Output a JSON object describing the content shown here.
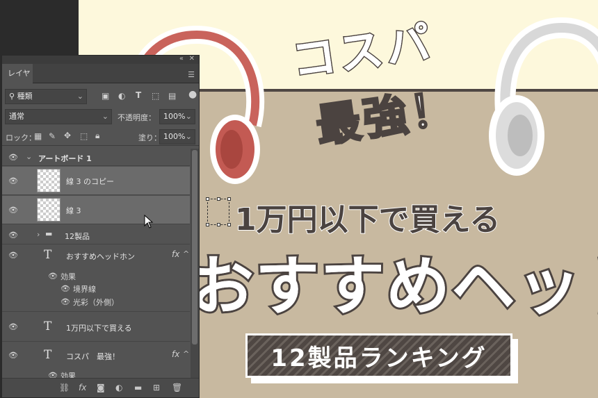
{
  "canvas": {
    "cospa_line1": "コスパ",
    "cospa_line2": "最強！",
    "subtitle": "1万円以下で買える",
    "main_title": "おすすめヘッドホン",
    "ranking_badge": "12製品ランキング",
    "colors": {
      "top_band": "#fdf8dc",
      "background": "#c8b9a0",
      "text_dark": "#4b4340",
      "headphone_red": "#c9635c"
    }
  },
  "panel": {
    "collapse_icon": "collapse-icon",
    "close_icon": "close-icon",
    "tab_label": "レイヤー",
    "filter": {
      "label": "種類",
      "icons": [
        "image-filter-icon",
        "adjustment-filter-icon",
        "type-filter-icon",
        "shape-filter-icon",
        "smartobject-filter-icon"
      ]
    },
    "blend_mode": "通常",
    "opacity_label": "不透明度：",
    "opacity_value": "100%",
    "lock_label": "ロック：",
    "fill_label": "塗り：",
    "fill_value": "100%",
    "layers": [
      {
        "name": "アートボード 1",
        "type": "artboard"
      },
      {
        "name": "線 3 のコピー",
        "type": "pixel"
      },
      {
        "name": "線 3",
        "type": "pixel"
      },
      {
        "name": "12製品",
        "type": "group"
      },
      {
        "name": "おすすめヘッドホン",
        "type": "text",
        "fx": "fx"
      },
      {
        "name": "効果",
        "type": "effects"
      },
      {
        "name": "境界線",
        "type": "effect"
      },
      {
        "name": "光彩（外側）",
        "type": "effect"
      },
      {
        "name": "1万円以下で買える",
        "type": "text"
      },
      {
        "name": "コスパ　最強！",
        "type": "text",
        "fx": "fx"
      },
      {
        "name": "効果",
        "type": "effects"
      }
    ],
    "bottom_icons": [
      "link-layers-icon",
      "fx-icon",
      "mask-icon",
      "adjustment-icon",
      "new-group-icon",
      "new-layer-icon",
      "trash-icon"
    ],
    "fx_label": "fx"
  }
}
